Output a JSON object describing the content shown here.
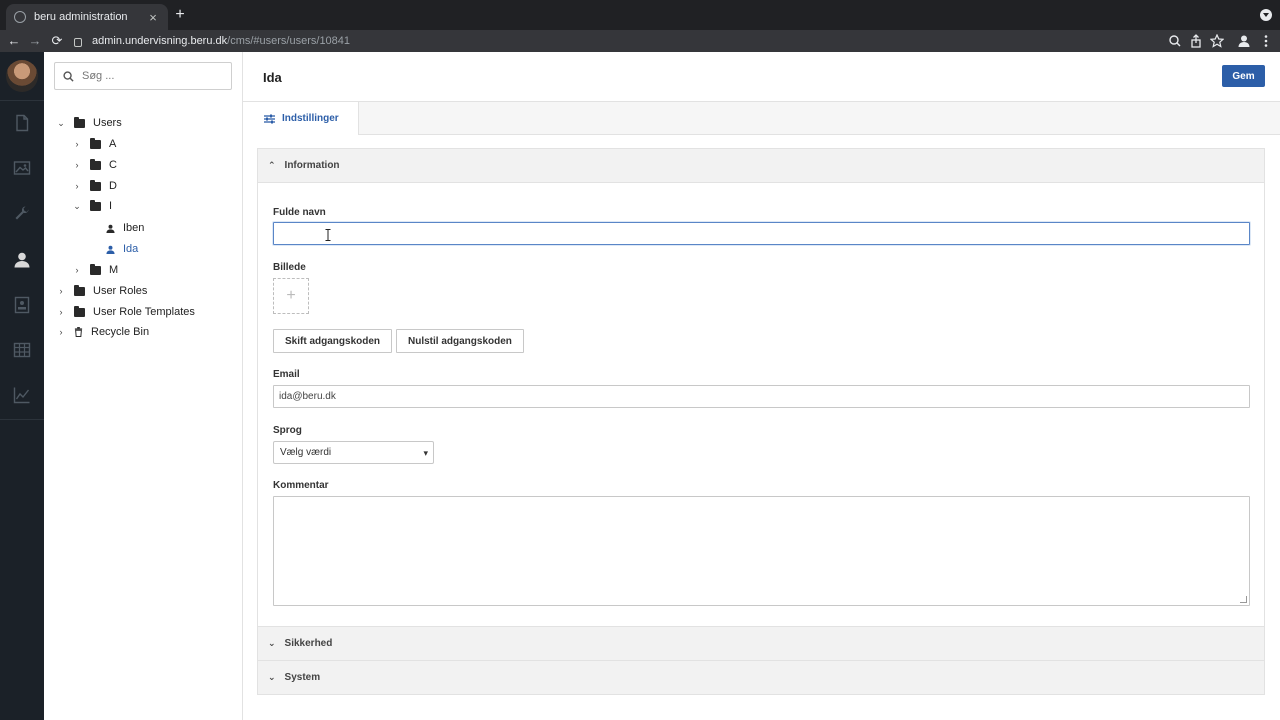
{
  "browser": {
    "tab_title": "beru administration",
    "tab_close": "×",
    "new_tab": "+",
    "url_host": "admin.undervisning.beru.dk",
    "url_path": "/cms/#users/users/10841",
    "back": "←",
    "forward": "→",
    "reload": "⟳"
  },
  "search": {
    "placeholder": "Søg ..."
  },
  "tree": {
    "users": "Users",
    "a": "A",
    "c": "C",
    "d": "D",
    "i": "I",
    "iben": "Iben",
    "ida": "Ida",
    "m": "M",
    "user_roles": "User Roles",
    "user_role_templates": "User Role Templates",
    "recycle_bin": "Recycle Bin"
  },
  "header": {
    "title": "Ida",
    "save_label": "Gem"
  },
  "tabs": {
    "settings": "Indstillinger"
  },
  "information": {
    "title": "Information",
    "full_name_label": "Fulde navn",
    "full_name_value": "",
    "image_label": "Billede",
    "change_password": "Skift adgangskoden",
    "reset_password": "Nulstil adgangskoden",
    "email_label": "Email",
    "email_value": "ida@beru.dk",
    "language_label": "Sprog",
    "language_value": "Vælg værdi",
    "comment_label": "Kommentar"
  },
  "sections": {
    "security": "Sikkerhed",
    "system": "System"
  },
  "colors": {
    "accent": "#2c5ea8",
    "rail": "#1b2128"
  }
}
